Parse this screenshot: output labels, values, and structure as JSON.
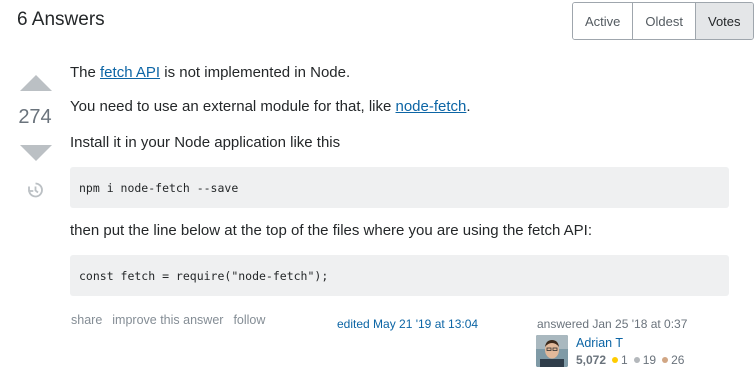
{
  "header": {
    "title": "6 Answers",
    "sort_tabs": [
      {
        "label": "Active"
      },
      {
        "label": "Oldest"
      },
      {
        "label": "Votes"
      }
    ]
  },
  "answer": {
    "score": "274",
    "p1_pre": "The ",
    "p1_link": "fetch API",
    "p1_post": " is not implemented in Node.",
    "p2_pre": "You need to use an external module for that, like ",
    "p2_link": "node-fetch",
    "p2_post": ".",
    "p3": "Install it in your Node application like this",
    "code1": "npm i node-fetch --save",
    "p4": "then put the line below at the top of the files where you are using the fetch API:",
    "code2": "const fetch = require(\"node-fetch\");",
    "menu": {
      "share": "share",
      "improve": "improve this answer",
      "follow": "follow"
    },
    "edited": "edited May 21 '19 at 13:04",
    "answered": "answered Jan 25 '18 at 0:37",
    "user": {
      "name": "Adrian T",
      "reputation": "5,072",
      "gold": "1",
      "silver": "19",
      "bronze": "26"
    }
  },
  "colors": {
    "link": "#0c65a5",
    "gold": "#ffcc01",
    "silver": "#b4b8bc",
    "bronze": "#d1a684"
  }
}
